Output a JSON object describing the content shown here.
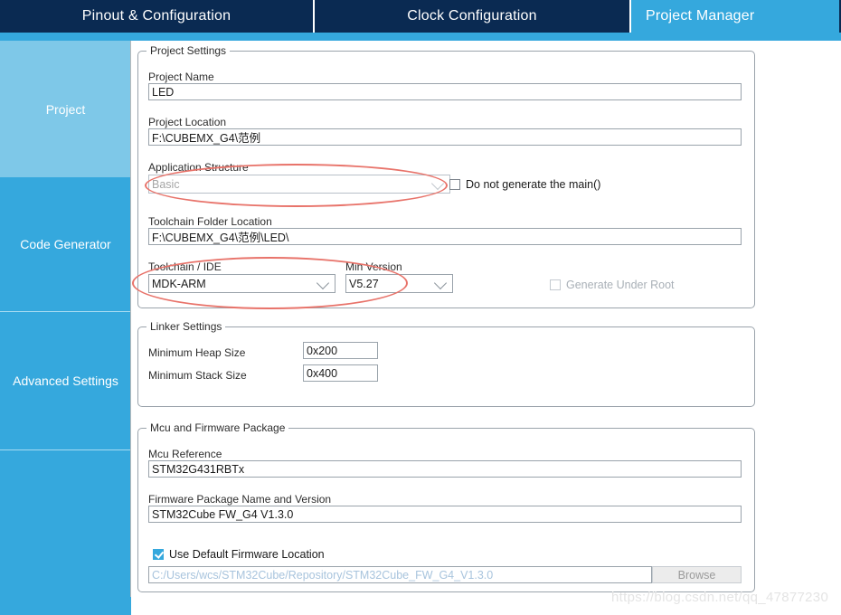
{
  "tabs": [
    {
      "label": "Pinout & Configuration",
      "selected": false
    },
    {
      "label": "Clock Configuration",
      "selected": false
    },
    {
      "label": "Project Manager",
      "selected": true
    }
  ],
  "sidebar": {
    "items": [
      {
        "label": "Project",
        "selected": true
      },
      {
        "label": "Code Generator",
        "selected": false
      },
      {
        "label": "Advanced Settings",
        "selected": false
      },
      {
        "label": "",
        "selected": false
      }
    ]
  },
  "project_settings": {
    "title": "Project Settings",
    "project_name_label": "Project Name",
    "project_name_value": "LED",
    "project_location_label": "Project Location",
    "project_location_value": "F:\\CUBEMX_G4\\范例",
    "application_structure_label": "Application Structure",
    "application_structure_value": "Basic",
    "do_not_generate_main_label": "Do not generate the main()",
    "do_not_generate_main_checked": false,
    "toolchain_folder_label": "Toolchain Folder Location",
    "toolchain_folder_value": "F:\\CUBEMX_G4\\范例\\LED\\",
    "toolchain_ide_label": "Toolchain / IDE",
    "toolchain_ide_value": "MDK-ARM",
    "min_version_label": "Min Version",
    "min_version_value": "V5.27",
    "generate_under_root_label": "Generate Under Root",
    "generate_under_root_checked": false
  },
  "linker_settings": {
    "title": "Linker Settings",
    "min_heap_label": "Minimum Heap Size",
    "min_heap_value": "0x200",
    "min_stack_label": "Minimum Stack Size",
    "min_stack_value": "0x400"
  },
  "mcu_firmware": {
    "title": "Mcu and Firmware Package",
    "mcu_reference_label": "Mcu Reference",
    "mcu_reference_value": "STM32G431RBTx",
    "firmware_package_label": "Firmware Package Name and Version",
    "firmware_package_value": "STM32Cube FW_G4 V1.3.0",
    "use_default_firmware_label": "Use Default Firmware Location",
    "use_default_firmware_checked": true,
    "firmware_path_value": "C:/Users/wcs/STM32Cube/Repository/STM32Cube_FW_G4_V1.3.0",
    "browse_label": "Browse"
  },
  "watermark": {
    "text": "https://blog.csdn.net/qq_47877230"
  },
  "colors": {
    "tab_inactive": "#0a2a52",
    "accent": "#35a8dd",
    "sidebar_selected": "#7ec8e8",
    "annotation_red": "#e8736a"
  }
}
